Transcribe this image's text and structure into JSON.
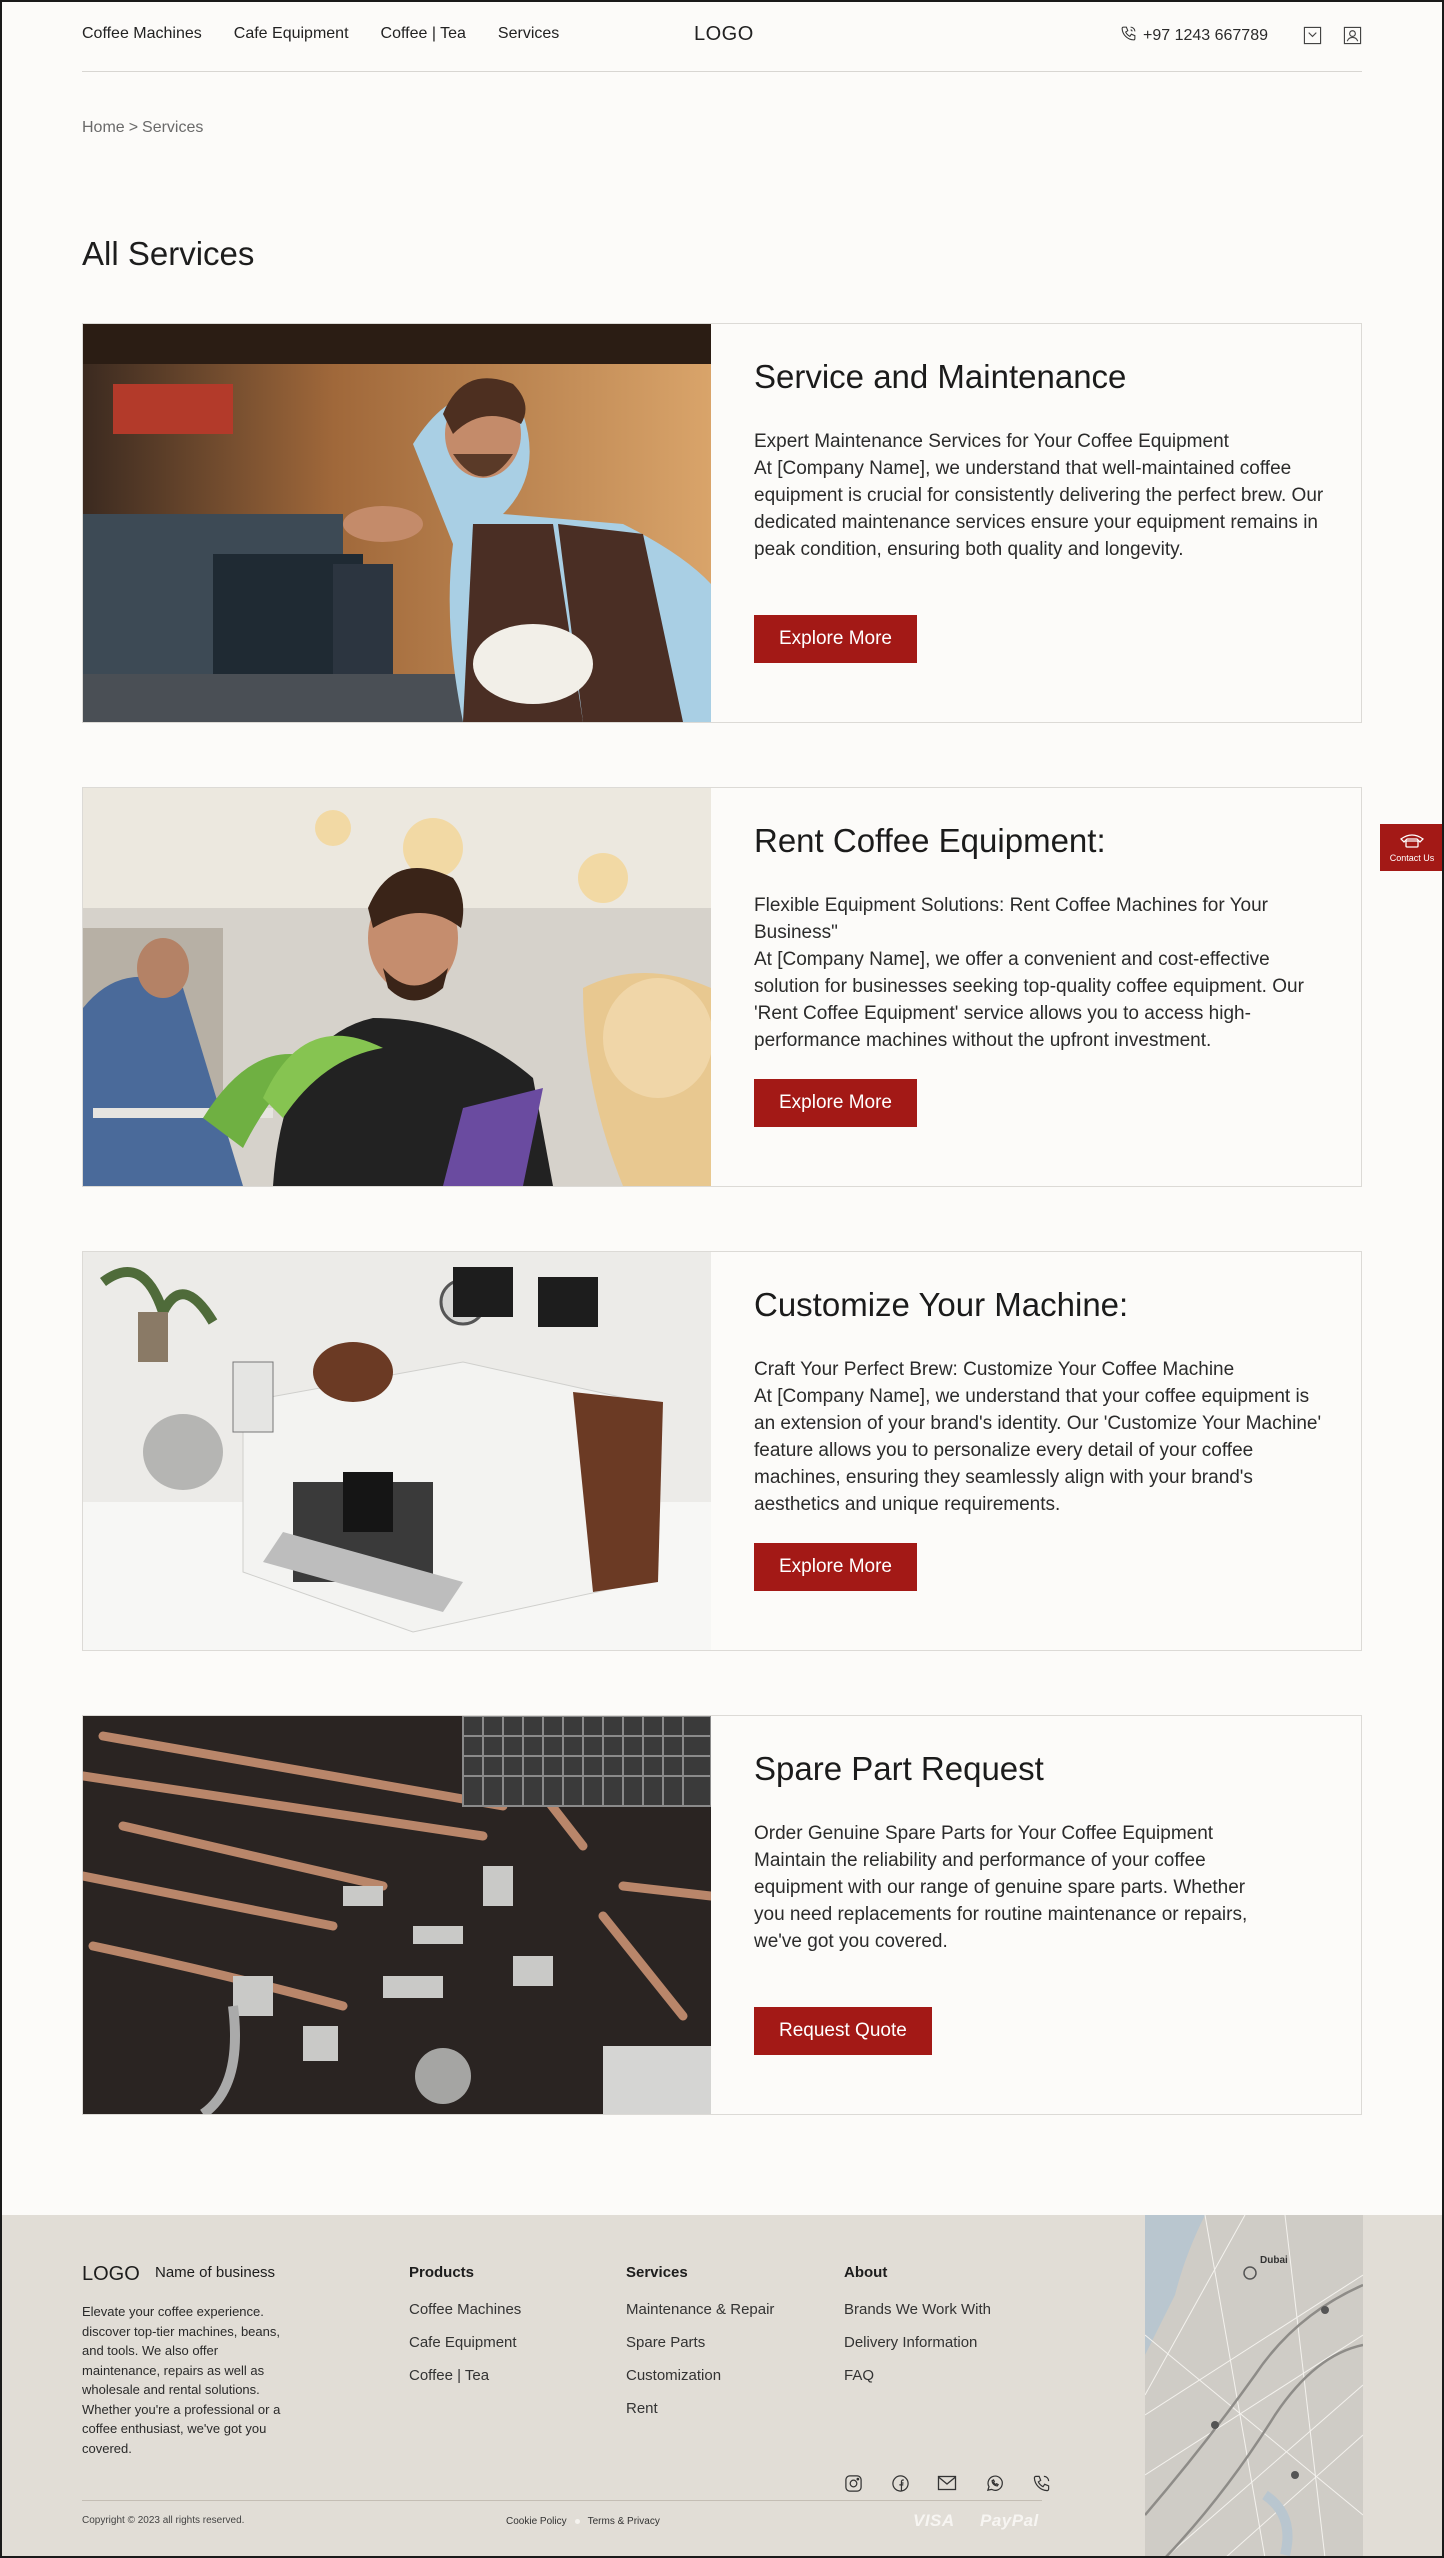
{
  "header": {
    "nav": [
      "Coffee Machines",
      "Cafe Equipment",
      "Coffee | Tea",
      "Services"
    ],
    "logo": "LOGO",
    "phone": "+97 1243 667789"
  },
  "breadcrumb": {
    "home": "Home",
    "separator": ">",
    "current": "Services"
  },
  "page_title": "All Services",
  "services": [
    {
      "title": "Service and Maintenance",
      "subtitle": "Expert Maintenance Services for Your Coffee Equipment",
      "description": "At [Company Name], we understand that well-maintained coffee equipment is crucial for consistently delivering the perfect brew. Our dedicated maintenance services ensure your equipment remains in peak condition, ensuring both quality and longevity.",
      "button": "Explore More"
    },
    {
      "title": "Rent Coffee Equipment:",
      "subtitle": "Flexible Equipment Solutions: Rent Coffee Machines for Your Business\"",
      "description": "At [Company Name], we offer a convenient and cost-effective solution for businesses seeking top-quality coffee equipment. Our 'Rent Coffee Equipment' service allows you to access high-performance machines without the upfront investment.",
      "button": "Explore More"
    },
    {
      "title": "Customize Your Machine:",
      "subtitle": "Craft Your Perfect Brew: Customize Your Coffee Machine",
      "description": "At [Company Name], we understand that your coffee equipment is an extension of your brand's identity. Our 'Customize Your Machine' feature allows you to personalize every detail of your coffee machines, ensuring they seamlessly align with your brand's aesthetics and unique requirements.",
      "button": "Explore More"
    },
    {
      "title": "Spare Part Request",
      "subtitle": "Order Genuine Spare Parts for Your Coffee Equipment",
      "description": "Maintain the reliability and performance of your coffee equipment with our range of genuine spare parts. Whether you need replacements for routine maintenance or repairs, we've got you covered.",
      "button": "Request Quote"
    }
  ],
  "contact_tab": "Contact Us",
  "footer": {
    "logo": "LOGO",
    "business_name": "Name of business",
    "about": "Elevate your coffee experience. discover top-tier machines, beans, and tools. We also offer maintenance, repairs as well as wholesale and rental solutions. Whether you're a professional or a coffee enthusiast, we've got you covered.",
    "columns": [
      {
        "heading": "Products",
        "links": [
          "Coffee Machines",
          "Cafe Equipment",
          "Coffee | Tea"
        ]
      },
      {
        "heading": "Services",
        "links": [
          "Maintenance & Repair",
          "Spare Parts",
          "Customization",
          "Rent"
        ]
      },
      {
        "heading": "About",
        "links": [
          "Brands We Work With",
          "Delivery Information",
          "FAQ"
        ]
      }
    ],
    "social_icons": [
      "instagram-icon",
      "facebook-icon",
      "mail-icon",
      "whatsapp-icon",
      "phone-icon"
    ],
    "copyright": "Copyright © 2023 all rights reserved.",
    "legal_links": [
      "Cookie Policy",
      "Terms & Privacy"
    ],
    "payments": [
      "VISA",
      "PayPal"
    ],
    "map_label": "Dubai"
  },
  "colors": {
    "accent": "#a31916",
    "background": "#fcfbf9",
    "footer": "#e1ddd6"
  }
}
